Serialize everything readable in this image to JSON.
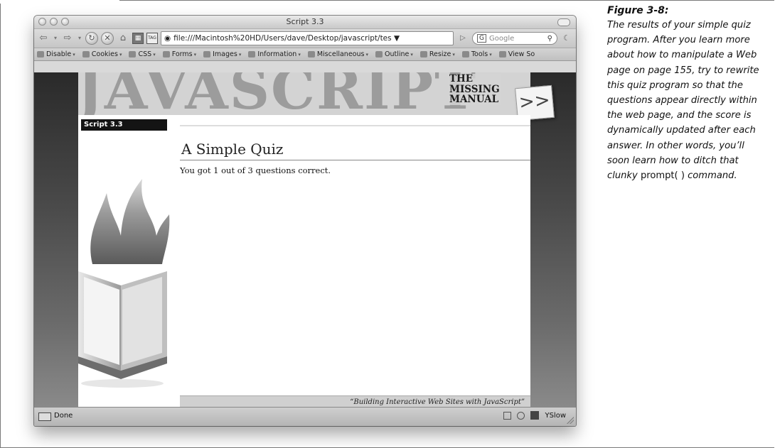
{
  "browser": {
    "window_title": "Script 3.3",
    "url": "file:///Macintosh%20HD/Users/dave/Desktop/javascript/tes ▼",
    "search_engine_badge": "G",
    "search_placeholder": "Google",
    "tag_label": "TAG",
    "devbar_items": [
      "Disable",
      "Cookies",
      "CSS",
      "Forms",
      "Images",
      "Information",
      "Miscellaneous",
      "Outline",
      "Resize",
      "Tools",
      "View So"
    ],
    "status_text": "Done",
    "status_yslow": "YSlow"
  },
  "page": {
    "banner_word": "JAVASCRIPT",
    "banner_sub_lines": [
      "THE",
      "MISSING",
      "MANUAL"
    ],
    "next_arrow": ">>",
    "sidebar_tab": "Script 3.3",
    "heading": "A Simple Quiz",
    "result": "You got 1 out of 3 questions correct.",
    "footer": "“Building Interactive Web Sites with JavaScript”"
  },
  "caption": {
    "title": "Figure 3-8:",
    "body_before": "The results of your simple quiz program. After you learn more about how to manipulate a Web page on page 155, try to rewrite this quiz program so that the questions appear directly within the web page, and the score is dynamically updated after each answer. In other words, you’ll soon learn how to ditch that clunky ",
    "code": "prompt( )",
    "body_after": " command."
  }
}
